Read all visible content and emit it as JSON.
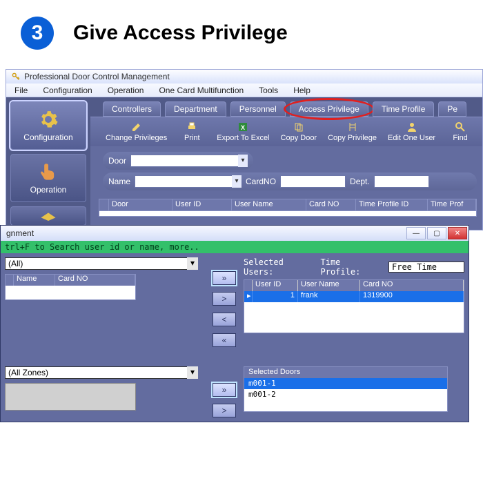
{
  "step": {
    "number": "3",
    "title": "Give Access Privilege"
  },
  "app": {
    "title": "Professional Door Control Management",
    "menus": {
      "file": "File",
      "configuration": "Configuration",
      "operation": "Operation",
      "onecard": "One Card Multifunction",
      "tools": "Tools",
      "help": "Help"
    },
    "side": {
      "configuration": "Configuration",
      "operation": "Operation"
    },
    "tabs": {
      "controllers": "Controllers",
      "department": "Department",
      "personnel": "Personnel",
      "access": "Access Privilege",
      "timeprofile": "Time Profile",
      "pe": "Pe"
    },
    "tools": {
      "change": "Change Privileges",
      "print": "Print",
      "export": "Export To Excel",
      "copydoor": "Copy Door",
      "copypriv": "Copy Privilege",
      "editone": "Edit One User",
      "find": "Find"
    },
    "filters": {
      "door_lbl": "Door",
      "name_lbl": "Name",
      "cardno_lbl": "CardNO",
      "dept_lbl": "Dept."
    },
    "grid": {
      "door": "Door",
      "userid": "User ID",
      "username": "User Name",
      "cardno": "Card NO",
      "tpid": "Time Profile ID",
      "tp": "Time Prof"
    }
  },
  "dlg": {
    "title_suffix": "gnment",
    "hint": "trl+F  to Search user id or name,  more..",
    "all": "(All)",
    "left_grid": {
      "name": "Name",
      "cardno": "Card NO"
    },
    "selected_users_lbl": "Selected Users:",
    "tp_lbl": "Time Profile:",
    "tp_val": "Free Time",
    "sel_head": {
      "uid": "User ID",
      "uname": "User Name",
      "cno": "Card NO"
    },
    "sel_row": {
      "uid": "1",
      "uname": "frank",
      "cno": "1319900"
    },
    "zones": "(All Zones)",
    "selected_doors_lbl": "Selected Doors",
    "doors": {
      "d1": "m001-1",
      "d2": "m001-2"
    },
    "btn": {
      "rr": "»",
      "r": ">",
      "l": "<",
      "ll": "«"
    }
  }
}
